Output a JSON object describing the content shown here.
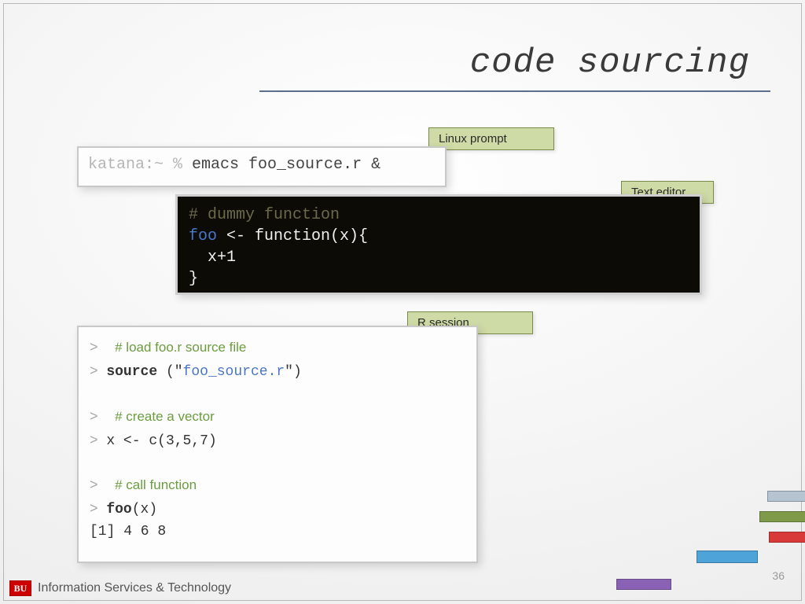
{
  "title": "code sourcing",
  "labels": {
    "linux": "Linux prompt",
    "editor": "Text editor",
    "rsession": "R session"
  },
  "linux": {
    "prompt": "katana:~ % ",
    "command": "emacs foo_source.r &"
  },
  "editor": {
    "comment": "# dummy function",
    "fname": "foo",
    "rest1": " <- function(x){",
    "body": "  x+1",
    "close": "}"
  },
  "rsession": {
    "c1": "# load foo.r source file",
    "l1a": "source",
    "l1b": " (\"",
    "l1c": "foo_source.r",
    "l1d": "\")",
    "c2": "# create a vector",
    "l2": "x <- c(3,5,7)",
    "c3": "# call function",
    "l3": "foo",
    "l3b": "(x)",
    "out": "[1] 4 6 8"
  },
  "footer": {
    "logo": "BU",
    "text": "Information Services & Technology"
  },
  "page": "36"
}
